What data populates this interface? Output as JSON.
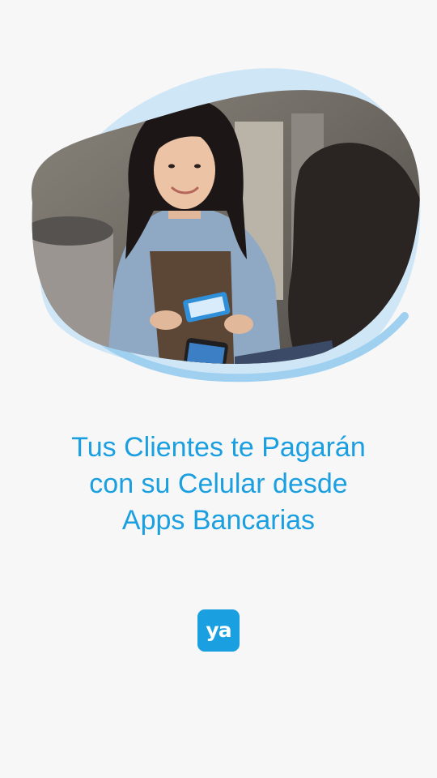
{
  "headline": {
    "line1": "Tus Clientes te Pagarán",
    "line2": "con su Celular desde",
    "line3": "Apps Bancarias"
  },
  "logo": {
    "text": "ya",
    "color": "#1a9fe0"
  },
  "hero": {
    "image": "cashier-showing-qr-code-customer-paying-with-phone",
    "accent_color": "#c8e3f5"
  },
  "colors": {
    "background": "#f7f7f8",
    "brand_blue": "#1a9fe0"
  }
}
